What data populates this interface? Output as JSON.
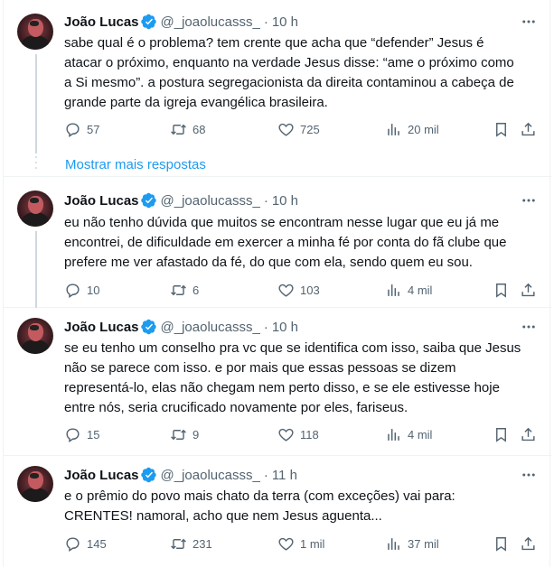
{
  "show_more_label": "Mostrar mais respostas",
  "tweets": [
    {
      "name": "João Lucas",
      "handle": "@_joaolucasss_",
      "time": "10 h",
      "lines": [
        "sabe qual é o problema? tem crente que acha que “defender” Jesus é",
        "atacar o próximo, enquanto na verdade Jesus disse: “ame o próximo como",
        "a Si mesmo”. a postura segregacionista da direita contaminou a cabeça de",
        "grande parte da igreja evangélica brasileira."
      ],
      "replies": "57",
      "retweets": "68",
      "likes": "725",
      "views": "20 mil"
    },
    {
      "name": "João Lucas",
      "handle": "@_joaolucasss_",
      "time": "10 h",
      "lines": [
        "eu não tenho dúvida que muitos se encontram nesse lugar que eu já me",
        "encontrei, de dificuldade em exercer a minha fé por conta do fã clube que",
        "prefere me ver afastado da fé, do que com ela, sendo quem eu sou."
      ],
      "replies": "10",
      "retweets": "6",
      "likes": "103",
      "views": "4 mil"
    },
    {
      "name": "João Lucas",
      "handle": "@_joaolucasss_",
      "time": "10 h",
      "lines": [
        "se eu tenho um conselho pra vc que se identifica com isso, saiba que Jesus",
        "não se parece com isso. e por mais que essas pessoas se dizem",
        "representá-lo, elas não chegam nem perto disso, e se ele estivesse hoje",
        "entre nós, seria crucificado novamente por eles, fariseus."
      ],
      "replies": "15",
      "retweets": "9",
      "likes": "118",
      "views": "4 mil"
    },
    {
      "name": "João Lucas",
      "handle": "@_joaolucasss_",
      "time": "11 h",
      "lines": [
        "e o prêmio do povo mais chato da terra (com exceções) vai para:",
        "CRENTES! namoral, acho que nem Jesus aguenta..."
      ],
      "replies": "145",
      "retweets": "231",
      "likes": "1 mil",
      "views": "37 mil"
    }
  ],
  "colors": {
    "accent": "#1d9bf0",
    "muted": "#536471",
    "text": "#0f1419",
    "border": "#eff3f4",
    "verified": "#1d9bf0"
  },
  "icons": [
    "verified-badge-icon",
    "more-icon",
    "reply-icon",
    "retweet-icon",
    "like-icon",
    "views-icon",
    "bookmark-icon",
    "share-icon"
  ]
}
